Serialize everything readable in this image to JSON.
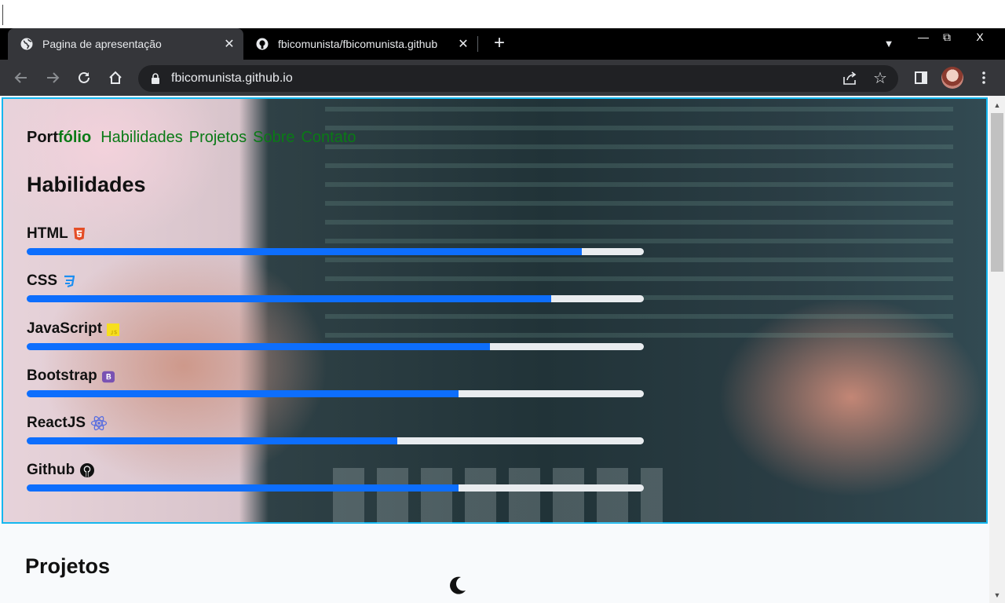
{
  "browser": {
    "tabs": [
      {
        "title": "Pagina de apresentação",
        "active": true,
        "favicon": "globe-icon"
      },
      {
        "title": "fbicomunista/fbicomunista.github",
        "active": false,
        "favicon": "github-icon"
      }
    ],
    "new_tab_label": "+",
    "url": "fbicomunista.github.io",
    "window_controls": {
      "minimize": "—",
      "restore": "⧉",
      "close": "X"
    }
  },
  "nav": {
    "brand_prefix": "Port",
    "brand_suffix": "fólio",
    "links": [
      "Habilidades",
      "Projetos",
      "Sobre",
      "Contato"
    ]
  },
  "skills_section": {
    "title": "Habilidades",
    "skills": [
      {
        "name": "HTML",
        "icon": "html5-icon",
        "level": 0.9
      },
      {
        "name": "CSS",
        "icon": "css3-icon",
        "level": 0.85
      },
      {
        "name": "JavaScript",
        "icon": "javascript-icon",
        "level": 0.75
      },
      {
        "name": "Bootstrap",
        "icon": "bootstrap-icon",
        "level": 0.7
      },
      {
        "name": "ReactJS",
        "icon": "react-icon",
        "level": 0.6
      },
      {
        "name": "Github",
        "icon": "github-icon",
        "level": 0.7
      }
    ]
  },
  "projects_section": {
    "title": "Projetos"
  },
  "colors": {
    "accent": "#15b7ef",
    "progress": "#0d6efd",
    "nav_link": "#0a7a16"
  }
}
